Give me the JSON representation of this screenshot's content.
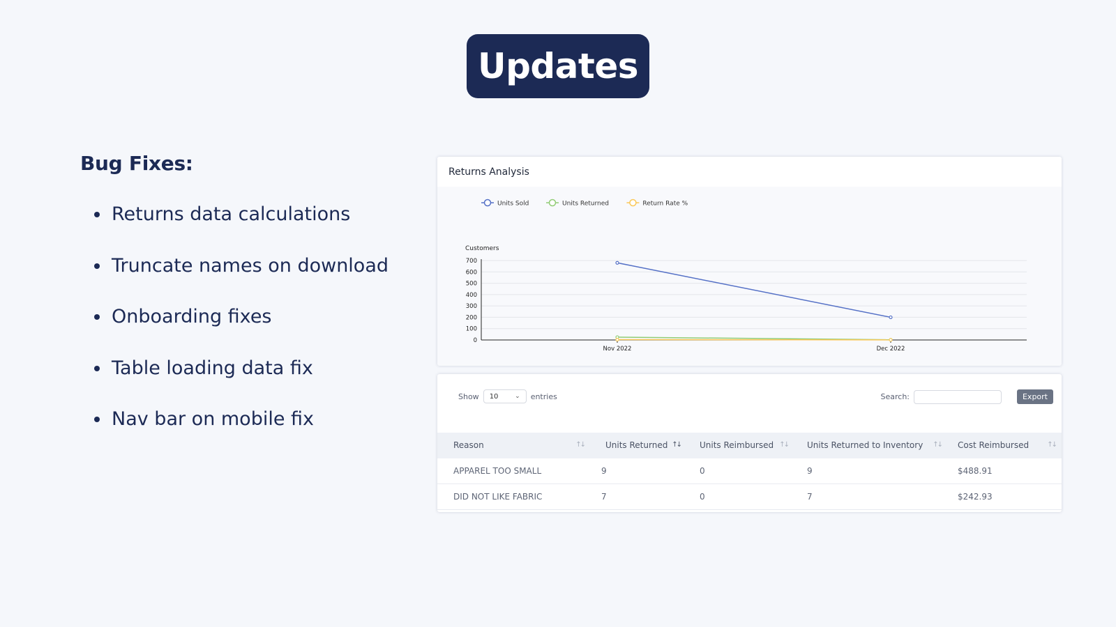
{
  "title": "Updates",
  "bug_fixes": {
    "heading": "Bug Fixes:",
    "items": [
      "Returns data calculations",
      "Truncate names on download",
      "Onboarding fixes",
      "Table loading data fix",
      "Nav bar on mobile fix"
    ]
  },
  "returns_chart": {
    "card_title": "Returns Analysis",
    "colors": {
      "units_sold": "#5470c6",
      "units_returned": "#91cc75",
      "return_rate": "#fac858"
    }
  },
  "chart_data": {
    "type": "line",
    "categories": [
      "Nov 2022",
      "Dec 2022"
    ],
    "series": [
      {
        "name": "Units Sold",
        "values": [
          680,
          200
        ]
      },
      {
        "name": "Units Returned",
        "values": [
          25,
          2
        ]
      },
      {
        "name": "Return Rate %",
        "values": [
          3,
          1
        ]
      }
    ],
    "title": "",
    "xlabel": "",
    "ylabel": "Customers",
    "ylim": [
      0,
      700
    ],
    "yticks": [
      0,
      100,
      200,
      300,
      400,
      500,
      600,
      700
    ],
    "grid": true,
    "legend": "top-left"
  },
  "table_controls": {
    "show_label": "Show",
    "entries_value": "10",
    "entries_label": "entries",
    "search_label": "Search:",
    "export_label": "Export"
  },
  "table": {
    "columns": [
      "Reason",
      "Units Returned",
      "Units Reimbursed",
      "Units Returned to Inventory",
      "Cost Reimbursed"
    ],
    "rows": [
      [
        "APPAREL TOO SMALL",
        "9",
        "0",
        "9",
        "$488.91"
      ],
      [
        "DID NOT LIKE FABRIC",
        "7",
        "0",
        "7",
        "$242.93"
      ]
    ]
  }
}
